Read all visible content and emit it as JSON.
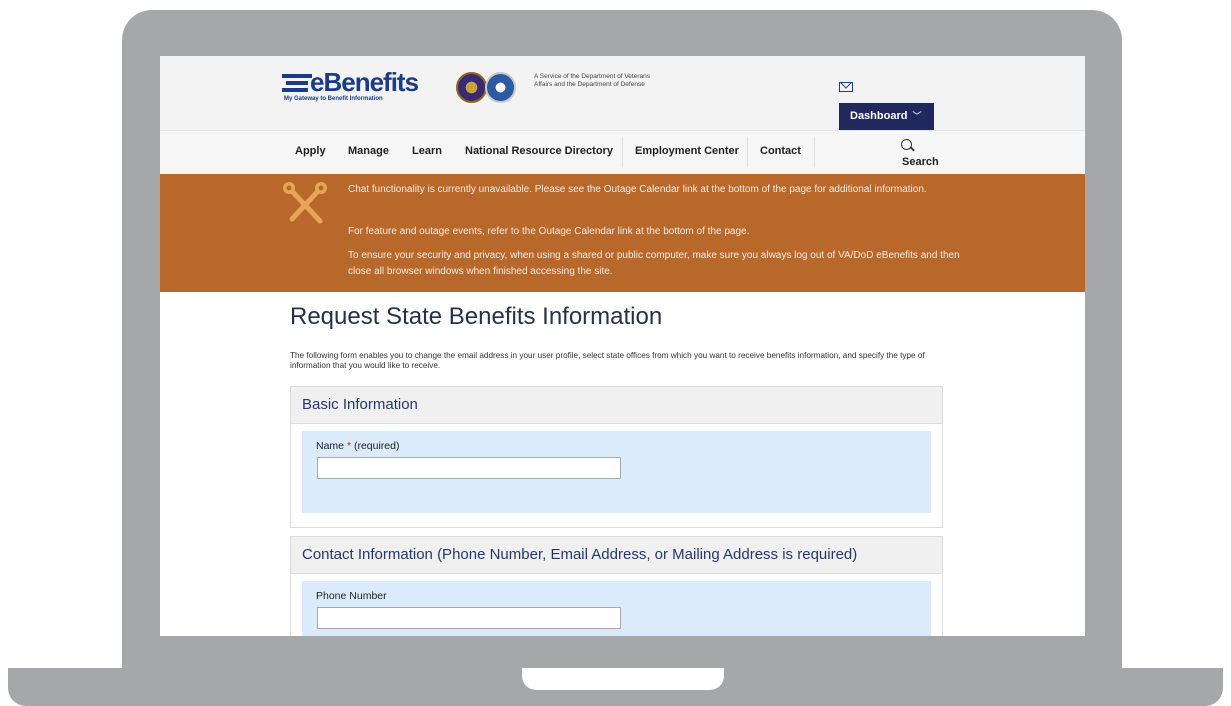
{
  "logo": {
    "title": "eBenefits",
    "tagline": "My Gateway to Benefit Information"
  },
  "header": {
    "service_text": "A Service of the Department of Veterans Affairs and the Department of Defense",
    "dashboard_label": "Dashboard"
  },
  "nav": {
    "items": [
      "Apply",
      "Manage",
      "Learn",
      "National Resource Directory",
      "Employment Center",
      "Contact"
    ],
    "search_label": "Search"
  },
  "alert": {
    "messages": [
      "Chat functionality is currently unavailable. Please see the Outage Calendar link at the bottom of the page for additional information.",
      "For feature and outage events, refer to the Outage Calendar link at the bottom of the page.",
      "To ensure your security and privacy, when using a shared or public computer, make sure you always log out of VA/DoD eBenefits and then close all browser windows when finished accessing the site."
    ]
  },
  "page": {
    "title": "Request State Benefits Information",
    "intro": "The following form enables you to change the email address in your user profile, select state offices from which you want to receive benefits information, and specify the type of information that you would like to receive."
  },
  "sections": [
    {
      "title": "Basic Information",
      "field_label": "Name",
      "required_mark": "*",
      "required_text": "(required)",
      "value": ""
    },
    {
      "title": "Contact Information (Phone Number, Email Address, or Mailing Address is required)",
      "field_label": "Phone Number",
      "value": ""
    }
  ],
  "colors": {
    "navy": "#20285c",
    "alert_orange": "#b9682c",
    "form_blue": "#dbebfb"
  }
}
